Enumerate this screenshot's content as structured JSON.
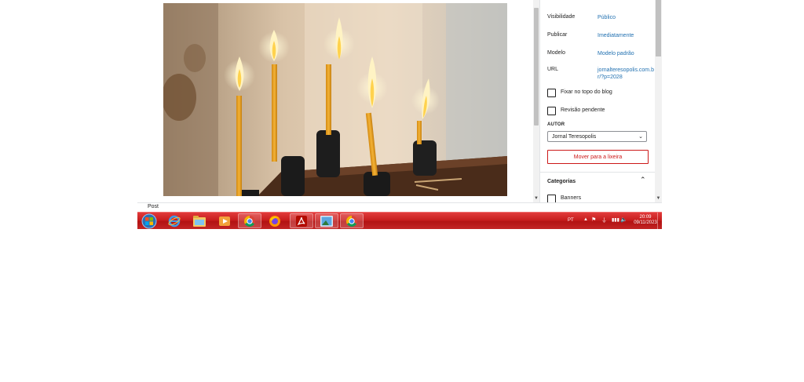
{
  "sidebar": {
    "rows": [
      {
        "label": "Visibilidade",
        "value": "Público"
      },
      {
        "label": "Publicar",
        "value": "Imediatamente"
      },
      {
        "label": "Modelo",
        "value": "Modelo padrão"
      },
      {
        "label": "URL",
        "value": "jornalteresopolis.com.br/?p=2028"
      }
    ],
    "checkboxes": [
      {
        "label": "Fixar no topo do blog"
      },
      {
        "label": "Revisão pendente"
      }
    ],
    "author_label": "AUTOR",
    "author_value": "Jornal Teresopolis",
    "trash_label": "Mover para a lixeira",
    "categories_title": "Categorias",
    "category_items": [
      {
        "label": "Banners"
      }
    ]
  },
  "footer": {
    "breadcrumb": "Post"
  },
  "taskbar": {
    "language": "PT",
    "time": "20:09",
    "date": "09/11/2023",
    "accent_color": "#c81e1e"
  },
  "colors": {
    "link": "#2271b1",
    "danger": "#cc1818"
  }
}
